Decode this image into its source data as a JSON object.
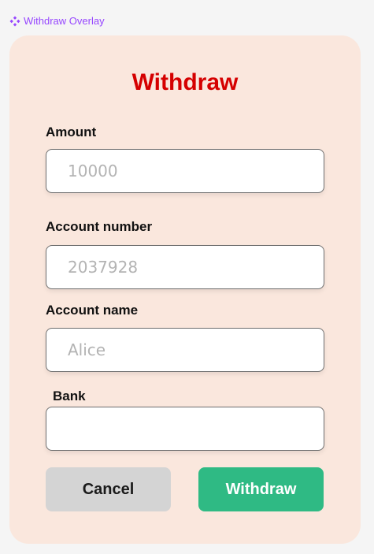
{
  "frame": {
    "label": "Withdraw Overlay",
    "icon": "component-icon",
    "label_color": "#9747ff"
  },
  "form": {
    "title": "Withdraw",
    "title_color": "#d50000",
    "background_color": "#fae7dd",
    "fields": [
      {
        "label": "Amount",
        "value": "",
        "placeholder": "10000"
      },
      {
        "label": "Account number",
        "value": "",
        "placeholder": "2037928"
      },
      {
        "label": "Account name",
        "value": "",
        "placeholder": "Alice"
      },
      {
        "label": "Bank",
        "value": "",
        "placeholder": ""
      }
    ],
    "cancel_label": "Cancel",
    "submit_label": "Withdraw",
    "cancel_color": "#d4d4d4",
    "submit_color": "#2fba84"
  }
}
